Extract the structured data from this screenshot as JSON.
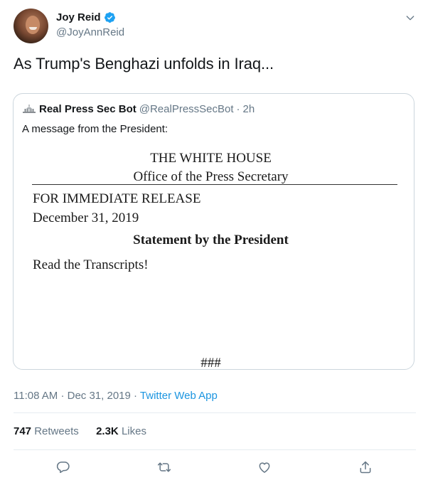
{
  "author": {
    "display_name": "Joy Reid",
    "handle": "@JoyAnnReid",
    "verified": true
  },
  "tweet_text": "As Trump's Benghazi unfolds in Iraq...",
  "quoted": {
    "display_name": "Real Press Sec Bot",
    "handle": "@RealPressSecBot",
    "separator": "·",
    "time": "2h",
    "text": "A message from the President:",
    "release": {
      "title": "THE WHITE HOUSE",
      "office": "Office of the Press Secretary",
      "immediate": "FOR IMMEDIATE RELEASE",
      "date": "December 31, 2019",
      "statement_title": "Statement by the President",
      "body": "Read the Transcripts!",
      "end_mark": "###"
    }
  },
  "meta": {
    "time": "11:08 AM",
    "separator": "·",
    "date": "Dec 31, 2019",
    "source": "Twitter Web App"
  },
  "stats": {
    "retweets_count": "747",
    "retweets_label": "Retweets",
    "likes_count": "2.3K",
    "likes_label": "Likes"
  },
  "icons": {
    "verified": "verified-badge-icon",
    "menu": "chevron-down-icon",
    "reply": "reply-icon",
    "retweet": "retweet-icon",
    "like": "heart-icon",
    "share": "share-icon"
  },
  "colors": {
    "text": "#14171a",
    "secondary": "#657786",
    "accent": "#1b95e0",
    "border": "#e6ecf0"
  }
}
